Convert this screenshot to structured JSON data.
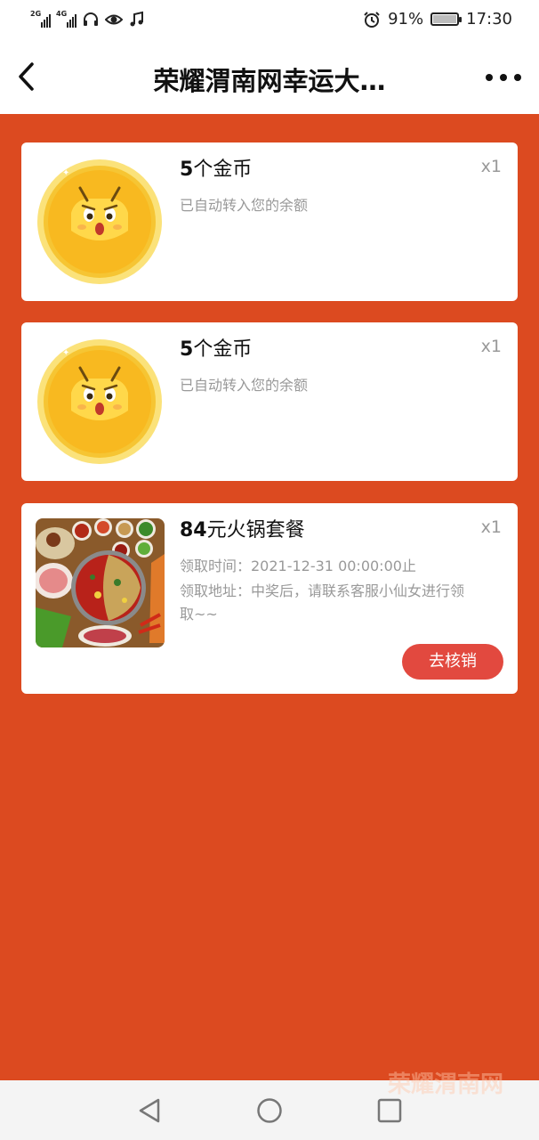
{
  "status_bar": {
    "sim1": "2G",
    "sim2": "4G",
    "battery_percent": "91%",
    "time": "17:30"
  },
  "header": {
    "title": "荣耀渭南网幸运大…"
  },
  "prizes": [
    {
      "title_num": "5",
      "title_text": "个金币",
      "quantity": "x1",
      "note": "已自动转入您的余额",
      "image": "gold-coin"
    },
    {
      "title_num": "5",
      "title_text": "个金币",
      "quantity": "x1",
      "note": "已自动转入您的余额",
      "image": "gold-coin"
    },
    {
      "title_num": "84",
      "title_text": "元火锅套餐",
      "quantity": "x1",
      "claim_time": "领取时间：2021-12-31 00:00:00止",
      "claim_address_line1": "领取地址：中奖后，请联系客服小仙女进行领",
      "claim_address_line2": "取~~",
      "action_label": "去核销",
      "image": "hotpot"
    }
  ],
  "watermark": "荣耀渭南网",
  "colors": {
    "background": "#dc4a20",
    "button": "#e2493f",
    "card": "#ffffff"
  }
}
